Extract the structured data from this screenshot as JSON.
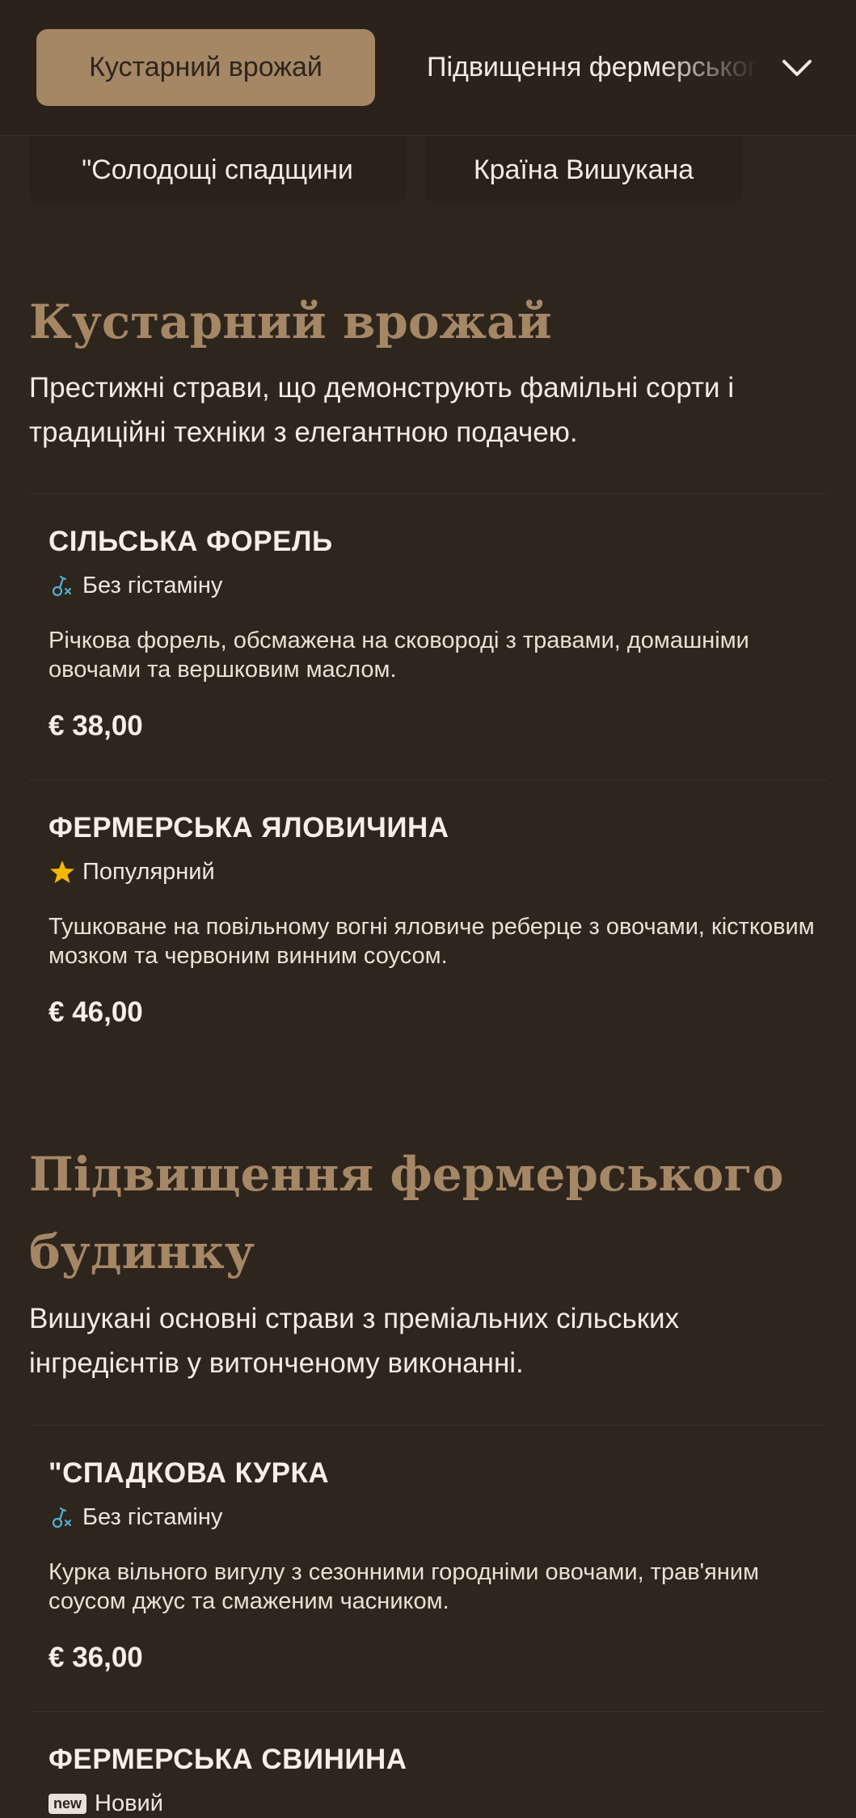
{
  "header": {
    "active_tab": "Кустарний врожай",
    "next_tab": "Підвищення фермерського будинку",
    "subtabs": [
      "\"Солодощі спадщини",
      "Країна Вишукана"
    ]
  },
  "sections": [
    {
      "title": "Кустарний врожай",
      "description": "Престижні страви, що демонструють фамільні сорти і традиційні техніки з елегантною подачею.",
      "items": [
        {
          "name": "СІЛЬСЬКА ФОРЕЛЬ",
          "tag_icon": "no-histamine-icon",
          "tag": "Без гістаміну",
          "description": "Річкова форель, обсмажена на сковороді з травами, домашніми овочами та вершковим маслом.",
          "price": "€ 38,00"
        },
        {
          "name": "ФЕРМЕРСЬКА ЯЛОВИЧИНА",
          "tag_icon": "star-icon",
          "tag": "Популярний",
          "description": "Тушковане на повільному вогні яловиче реберце з овочами, кістковим мозком та червоним винним соусом.",
          "price": "€ 46,00"
        }
      ]
    },
    {
      "title": "Підвищення фермерського будинку",
      "description": "Вишукані основні страви з преміальних сільських інгредієнтів у витонченому виконанні.",
      "items": [
        {
          "name": "\"СПАДКОВА КУРКА",
          "tag_icon": "no-histamine-icon",
          "tag": "Без гістаміну",
          "description": "Курка вільного вигулу з сезонними городніми овочами, трав'яним соусом джус та смаженим часником.",
          "price": "€ 36,00"
        },
        {
          "name": "ФЕРМЕРСЬКА СВИНИНА",
          "tag_icon": "new-badge-icon",
          "badge": "new",
          "tag": "Новий"
        }
      ]
    }
  ],
  "colors": {
    "background": "#2e251d",
    "accent": "#a58766",
    "star": "#f5b800",
    "histamine_icon": "#4fb3d9"
  }
}
